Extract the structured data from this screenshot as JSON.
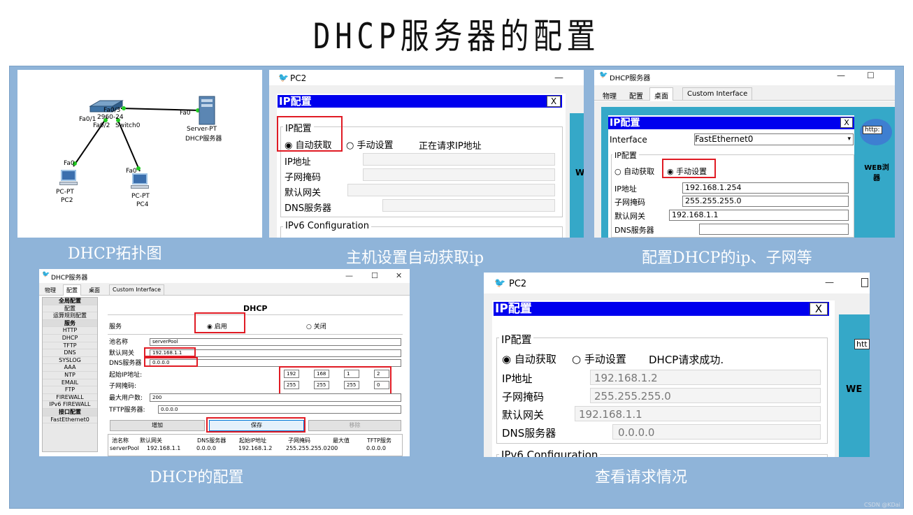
{
  "slide_title": "DHCP服务器的配置",
  "captions": {
    "topology": "DHCP拓扑图",
    "host_auto": "主机设置自动获取ip",
    "server_config": "配置DHCP的ip、子网等",
    "dhcp_config": "DHCP的配置",
    "check": "查看请求情况"
  },
  "topology": {
    "port_switch_top": "Fa0/3",
    "port_switch_left": "Fa0/1",
    "switch_model": "2960-24",
    "port_switch_bottom": "Fa0/2",
    "switch_name": "Switch0",
    "server_port": "Fa0",
    "server_type": "Server-PT",
    "server_name": "DHCP服务器",
    "pc2_port": "Fa0",
    "pc2_type": "PC-PT",
    "pc2_name": "PC2",
    "pc4_port": "Fa0",
    "pc4_type": "PC-PT",
    "pc4_name": "PC4"
  },
  "pc2_request": {
    "window_title": "PC2",
    "min": "—",
    "header": "IP配置",
    "close": "X",
    "group": "IP配置",
    "auto": "自动获取",
    "manual": "手动设置",
    "status": "正在请求IP地址",
    "ip_label": "IP地址",
    "mask_label": "子网掩码",
    "gw_label": "默认网关",
    "dns_label": "DNS服务器",
    "ipv6": "IPv6 Configuration",
    "side_letter": "W"
  },
  "server_window": {
    "title": "DHCP服务器",
    "min": "—",
    "max": "☐",
    "tabs": [
      "物理",
      "配置",
      "桌面",
      "Custom Interface"
    ],
    "header": "IP配置",
    "close": "X",
    "interface_label": "Interface",
    "interface_value": "FastEthernet0",
    "group": "IP配置",
    "auto": "自动获取",
    "manual": "手动设置",
    "ip_label": "IP地址",
    "ip_value": "192.168.1.254",
    "mask_label": "子网掩码",
    "mask_value": "255.255.255.0",
    "gw_label": "默认网关",
    "gw_value": "192.168.1.1",
    "dns_label": "DNS服务器",
    "http_badge": "http:",
    "web_label": "WEB浏",
    "web_label2": "器"
  },
  "dhcp_window": {
    "title": "DHCP服务器",
    "min": "—",
    "max": "☐",
    "close": "✕",
    "tabs": [
      "物理",
      "配置",
      "桌面",
      "Custom Interface"
    ],
    "sidebar": [
      "全局配置",
      "配置",
      "运算规则配置",
      "服务",
      "HTTP",
      "DHCP",
      "TFTP",
      "DNS",
      "SYSLOG",
      "AAA",
      "NTP",
      "EMAIL",
      "FTP",
      "FIREWALL",
      "IPv6 FIREWALL",
      "接口配置",
      "FastEthernet0"
    ],
    "heading": "DHCP",
    "service_label": "服务",
    "on_label": "启用",
    "off_label": "关闭",
    "pool_label": "池名称",
    "pool_value": "serverPool",
    "gw_label": "默认网关",
    "gw_value": "192.168.1.1",
    "dns_label": "DNS服务器",
    "dns_value": "0.0.0.0",
    "start_label": "起始IP地址:",
    "start_ip": [
      "192",
      "168",
      "1",
      "2"
    ],
    "mask_label": "子网掩码:",
    "mask": [
      "255",
      "255",
      "255",
      "0"
    ],
    "max_label": "最大用户数:",
    "max_value": "200",
    "tftp_label": "TFTP服务器:",
    "tftp_value": "0.0.0.0",
    "add_btn": "增加",
    "save_btn": "保存",
    "remove_btn": "移除",
    "table_headers": [
      "池名称",
      "默认网关",
      "DNS服务器",
      "起始IP地址",
      "子网掩码",
      "最大值",
      "TFTP服务"
    ],
    "table_row": [
      "serverPool",
      "192.168.1.1",
      "0.0.0.0",
      "192.168.1.2",
      "255.255.255.0",
      "200",
      "0.0.0.0"
    ]
  },
  "pc2_success": {
    "window_title": "PC2",
    "min": "—",
    "header": "IP配置",
    "close": "X",
    "group": "IP配置",
    "auto": "自动获取",
    "manual": "手动设置",
    "status": "DHCP请求成功.",
    "ip_label": "IP地址",
    "ip_value": "192.168.1.2",
    "mask_label": "子网掩码",
    "mask_value": "255.255.255.0",
    "gw_label": "默认网关",
    "gw_value": "192.168.1.1",
    "dns_label": "DNS服务器",
    "dns_value": "0.0.0.0",
    "ipv6": "IPv6 Configuration",
    "side_http": "htt",
    "side_web": "WE"
  },
  "watermark": "CSDN @KDai"
}
